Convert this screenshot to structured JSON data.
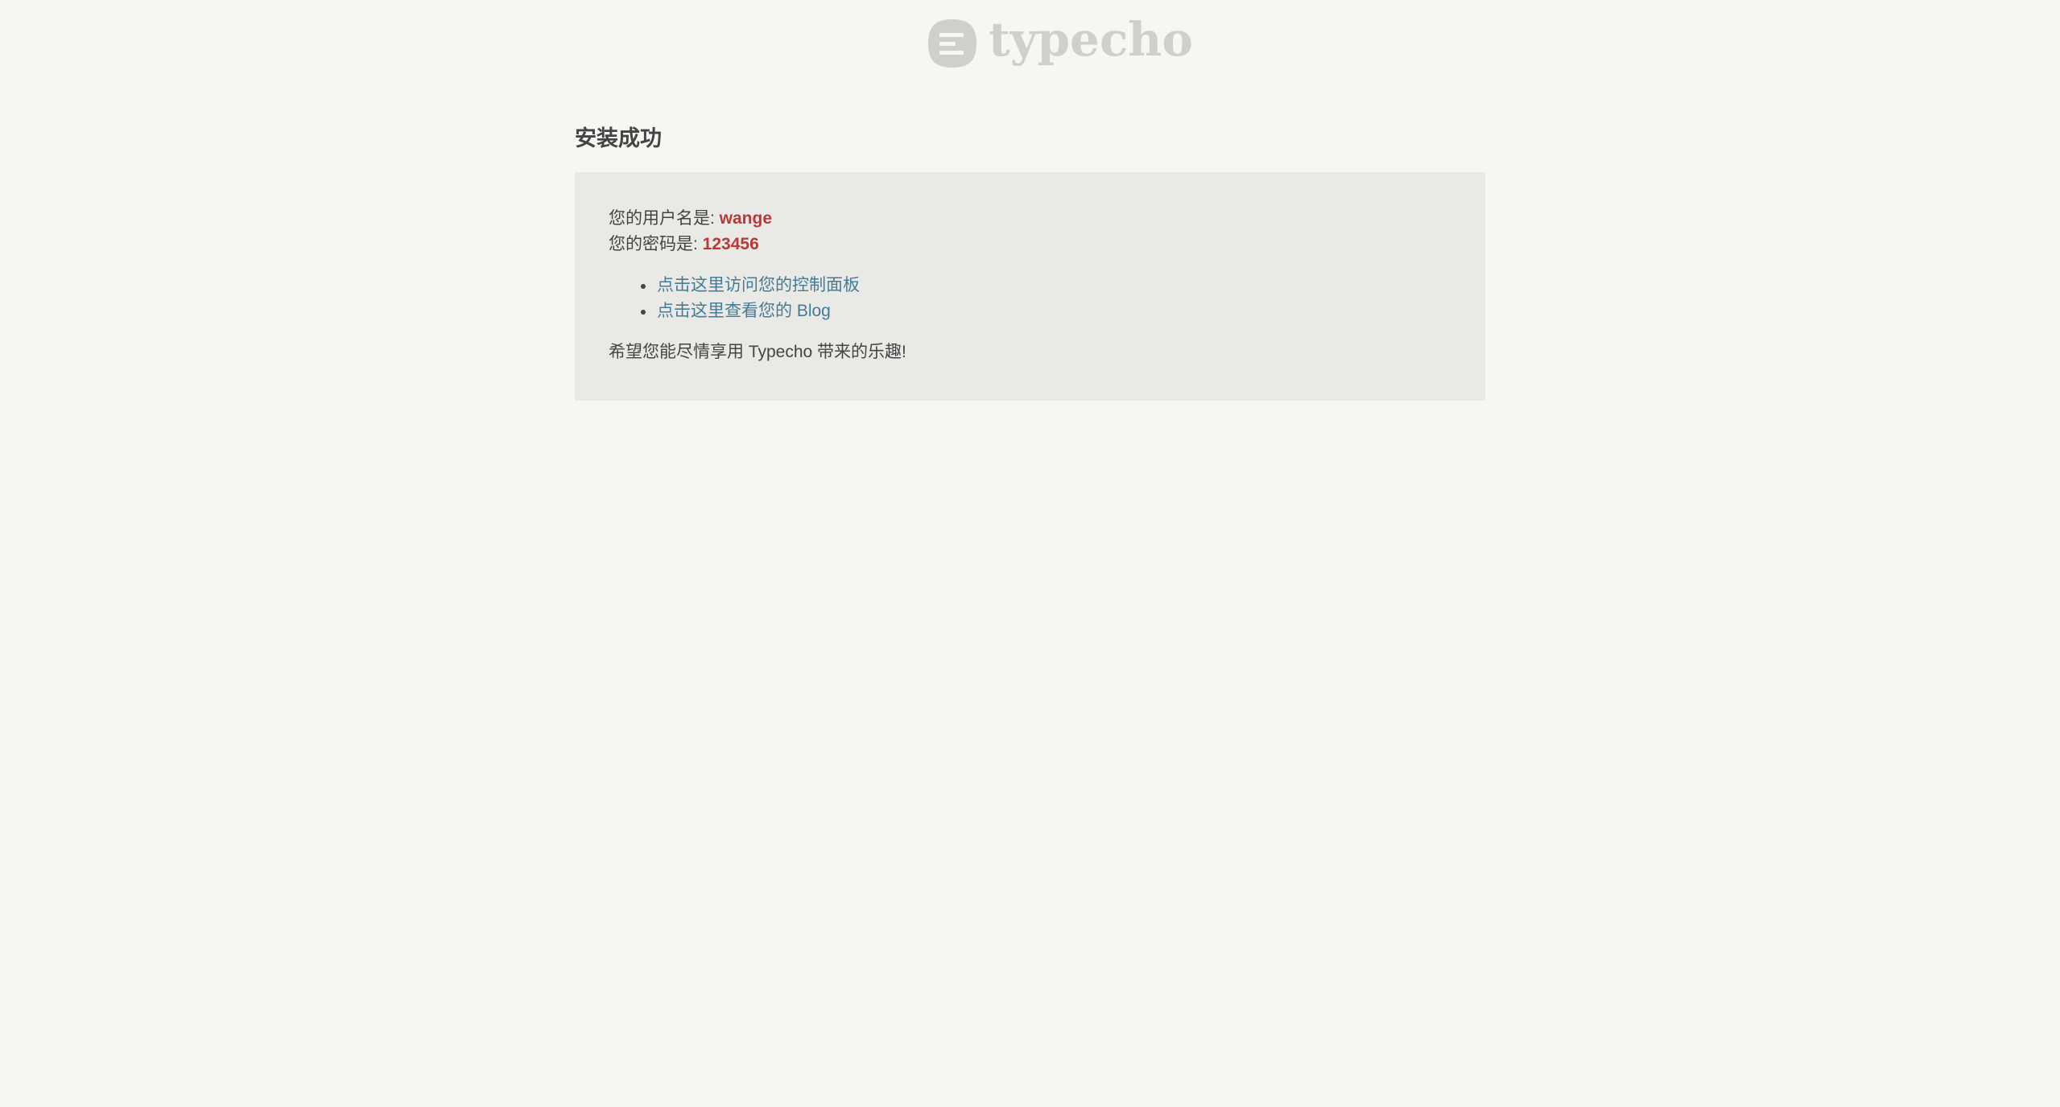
{
  "brand": {
    "logo_text": "typecho",
    "logo_icon": "typecho-logo-icon"
  },
  "page": {
    "title": "安装成功"
  },
  "credentials": {
    "username_label": "您的用户名是: ",
    "username_value": "wange",
    "password_label": "您的密码是: ",
    "password_value": "123456"
  },
  "links": [
    {
      "label": "点击这里访问您的控制面板"
    },
    {
      "label": "点击这里查看您的 Blog"
    }
  ],
  "closing_text": "希望您能尽情享用 Typecho 带来的乐趣!",
  "colors": {
    "background": "#f6f6f3",
    "panel": "#e9e9e6",
    "highlight": "#b9393a",
    "link": "#467b96",
    "logo": "#cfcfcd"
  }
}
